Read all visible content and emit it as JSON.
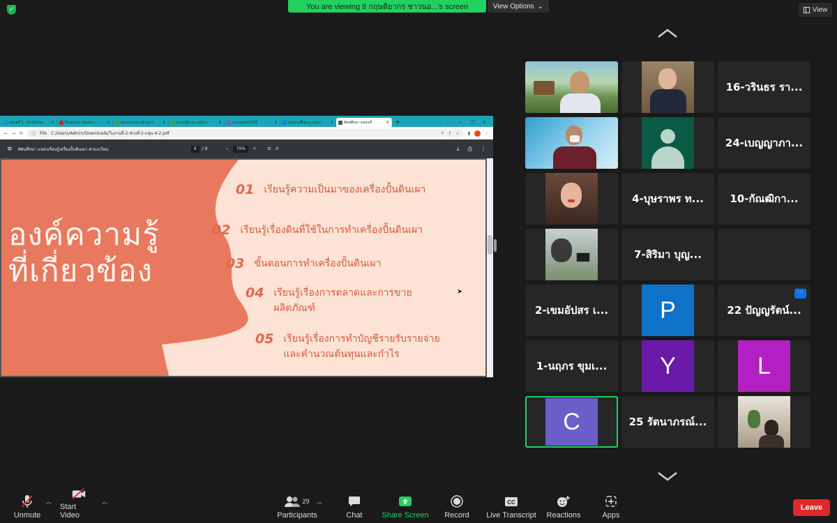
{
  "top": {
    "banner": "You are viewing 8 กฤษติยากร ชาวนอ...'s screen",
    "view_options": "View Options",
    "view": "View"
  },
  "browser": {
    "tabs": [
      {
        "label": "หน่วยที่ 1 - OneDrive",
        "color": "#1e88e5"
      },
      {
        "label": "Financial Literacy",
        "color": "#c62828"
      },
      {
        "label": "บุคคลากรทางด้านการ",
        "color": "#43a047"
      },
      {
        "label": "ความรู้ด้านการเงิน ก",
        "color": "#43a047"
      },
      {
        "label": "ระบบออนไลน์ได้",
        "color": "#7e57c2"
      },
      {
        "label": "ปรับปรุงพื้นฐาน แผนก",
        "color": "#1877f2"
      },
      {
        "label": "ทัศนศึกษา แหล่งเรี",
        "color": "#555555"
      }
    ],
    "address": "C:/Users/Admin/Downloads/ใบงานที่-2-ช่วงที่-2-กลุ่ม-4-2.pdf",
    "file_label": "File",
    "pdf_title": "ทัศนศึกษา แหล่งเรียนรู้เครื่องปั้นดินเผา ด่านเกวียน",
    "page_current": "4",
    "page_total": "/ 9",
    "zoom": "70%"
  },
  "slide": {
    "heading_line1": "องค์ความรู้",
    "heading_line2": "ที่เกี่ยวข้อง",
    "items": [
      {
        "num": "01",
        "text": "เรียนรู้ความเป็นมาของเครื่องปั้นดินเผา"
      },
      {
        "num": "02",
        "text": "เรียนรู้เรื่องดินที่ใช้ในการทำเครื่องปั้นดินเผา"
      },
      {
        "num": "03",
        "text": "ขั้นตอนการทำเครื่องปั้นดินเผา"
      },
      {
        "num": "04",
        "text": "เรียนรู้เรื่องการตลาดและการขาย",
        "text2": "ผลิตภัณฑ์"
      },
      {
        "num": "05",
        "text": "เรียนรู้เรื่องการทำบัญชีรายรับรายจ่าย",
        "text2": "และคำนวณต้นทุนและกำไร"
      }
    ]
  },
  "participants_tiles": {
    "name_16": "16-วรินธร รา...",
    "name_24": "24-เบญญาภา...",
    "name_4": "4-บุษราพร ท...",
    "name_10": "10-กัณฒิกา...",
    "name_7": "7-สิริมา บุญ...",
    "name_2": "2-เขมอัปสร เ...",
    "letter_p": "P",
    "name_22": "22 ปัญญรัตน์...",
    "name_1": "1-นฤภร ขุมเ...",
    "letter_y": "Y",
    "letter_l": "L",
    "letter_c": "C",
    "name_25": "25 รัตนาภรณ์...",
    "more": "···"
  },
  "toolbar": {
    "unmute": "Unmute",
    "start_video": "Start Video",
    "participants": "Participants",
    "participant_count": "29",
    "chat": "Chat",
    "share_screen": "Share Screen",
    "record": "Record",
    "live_transcript": "Live Transcript",
    "reactions": "Reactions",
    "apps": "Apps",
    "leave": "Leave"
  },
  "colors": {
    "accent_green": "#23d160",
    "leave_red": "#e02828",
    "slide_bg": "#fde3d5",
    "slide_shape": "#e8785e"
  }
}
